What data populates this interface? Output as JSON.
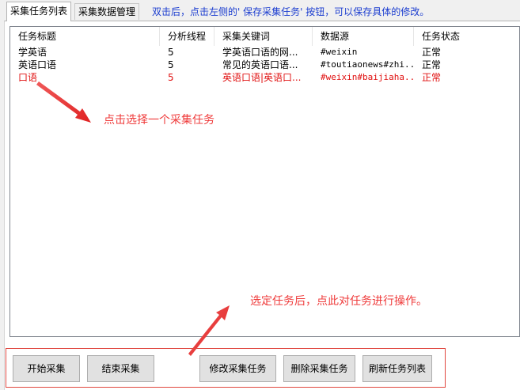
{
  "tabs": [
    {
      "label": "采集任务列表"
    },
    {
      "label": "采集数据管理"
    }
  ],
  "hint": "双击后，点击左侧的' 保存采集任务' 按钮，可以保存具体的修改。",
  "list": {
    "columns": [
      "任务标题",
      "分析线程",
      "采集关键词",
      "数据源",
      "任务状态"
    ],
    "rows": [
      {
        "title": "学英语",
        "threads": "5",
        "keywords": "学英语口语的网...",
        "source": "#weixin",
        "status": "正常"
      },
      {
        "title": "英语口语",
        "threads": "5",
        "keywords": "常见的英语口语...",
        "source": "#toutiaonews#zhi...",
        "status": "正常"
      },
      {
        "title": "口语",
        "threads": "5",
        "keywords": "英语口语|英语口...",
        "source": "#weixin#baijiaha...",
        "status": "正常"
      }
    ]
  },
  "annotations": {
    "select_hint": "点击选择一个采集任务",
    "operate_hint": "选定任务后，点此对任务进行操作。"
  },
  "buttons": {
    "start": "开始采集",
    "stop": "结束采集",
    "edit": "修改采集任务",
    "delete": "删除采集任务",
    "refresh": "刷新任务列表"
  },
  "colors": {
    "selected_row_text": "#e01010",
    "annotation": "#ef3b3b",
    "hint_text": "#1a3ccf"
  }
}
